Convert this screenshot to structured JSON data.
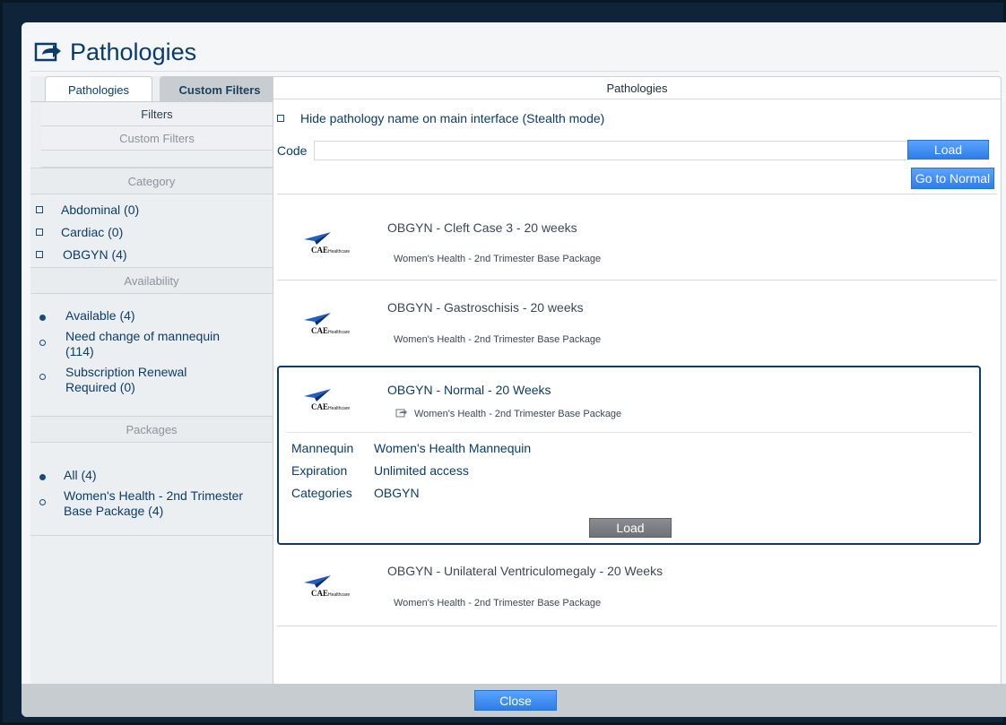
{
  "dialog": {
    "title": "Pathologies",
    "title_icon": "share-arrow-icon"
  },
  "left": {
    "tabs": [
      {
        "label": "Pathologies",
        "active": true
      },
      {
        "label": "Custom Filters",
        "active": false
      }
    ],
    "filters_label": "Filters",
    "custom_filters_label": "Custom Filters",
    "category_header": "Category",
    "categories": [
      {
        "label": "Abdominal (0)",
        "checked": false
      },
      {
        "label": "Cardiac (0)",
        "checked": false
      },
      {
        "label": "OBGYN (4)",
        "checked": false
      }
    ],
    "availability_header": "Availability",
    "availability": [
      {
        "label": "Available (4)",
        "selected": true
      },
      {
        "label": "Need change of mannequin (114)",
        "selected": false
      },
      {
        "label": "Subscription Renewal Required (0)",
        "selected": false
      }
    ],
    "packages_header": "Packages",
    "packages": [
      {
        "label": "All (4)",
        "selected": true
      },
      {
        "label": "Women's Health - 2nd Trimester Base Package (4)",
        "selected": false
      }
    ]
  },
  "right": {
    "header": "Pathologies",
    "stealth_label": "Hide pathology name on main interface (Stealth mode)",
    "code_label": "Code",
    "code_value": "",
    "load_label": "Load",
    "go_normal_label": "Go to Normal",
    "logo_text": "CAE",
    "logo_subtext": "Healthcare",
    "items": [
      {
        "title": "OBGYN - Cleft Case 3 - 20 weeks",
        "package": "Women's Health - 2nd Trimester Base Package"
      },
      {
        "title": "OBGYN - Gastroschisis - 20 weeks",
        "package": "Women's Health - 2nd Trimester Base Package"
      },
      {
        "title": "OBGYN - Normal - 20 Weeks",
        "package": "Women's Health - 2nd Trimester Base Package",
        "details": {
          "mannequin_label": "Mannequin",
          "mannequin": "Women's Health Mannequin",
          "expiration_label": "Expiration",
          "expiration": "Unlimited access",
          "categories_label": "Categories",
          "categories": "OBGYN",
          "load_label": "Load"
        }
      },
      {
        "title": "OBGYN - Unilateral Ventriculomegaly - 20 Weeks",
        "package": "Women's Health - 2nd Trimester Base Package"
      }
    ]
  },
  "footer": {
    "close_label": "Close"
  },
  "colors": {
    "accent": "#2e7ee6",
    "text": "#0b3c69",
    "panel": "#eceff2"
  }
}
